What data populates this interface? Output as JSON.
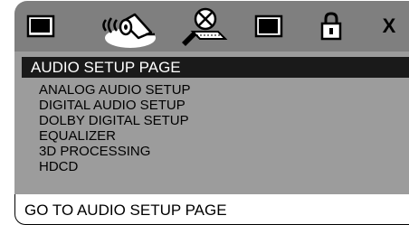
{
  "icons": [
    {
      "name": "general-setup-icon",
      "active": false
    },
    {
      "name": "audio-setup-icon",
      "active": true
    },
    {
      "name": "dolby-film-icon",
      "active": false
    },
    {
      "name": "video-setup-icon",
      "active": false
    },
    {
      "name": "lock-icon",
      "active": false
    },
    {
      "name": "exit-icon",
      "label": "X",
      "active": false
    }
  ],
  "menu": {
    "title": "AUDIO SETUP PAGE",
    "items": [
      {
        "label": "ANALOG AUDIO SETUP"
      },
      {
        "label": "DIGITAL AUDIO SETUP"
      },
      {
        "label": "DOLBY DIGITAL SETUP"
      },
      {
        "label": "EQUALIZER"
      },
      {
        "label": "3D PROCESSING"
      },
      {
        "label": "HDCD"
      }
    ]
  },
  "status": {
    "text": "GO TO AUDIO SETUP PAGE"
  },
  "colors": {
    "iconbar_bg": "#7f7f7f",
    "menu_bg": "#9c9c9c",
    "title_bg": "#1a1a1a",
    "footer_bg": "#ffffff"
  }
}
